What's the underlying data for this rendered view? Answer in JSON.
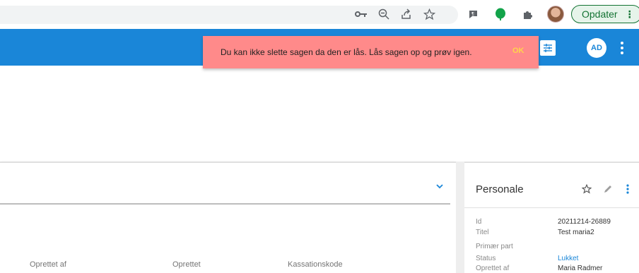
{
  "browser": {
    "icons": [
      "key-icon",
      "zoom-out-icon",
      "share-icon",
      "bookmark-star-icon",
      "extension-app-icon",
      "extension-green-icon",
      "puzzle-icon",
      "profile-avatar"
    ],
    "update_label": "Opdater",
    "update_more": "⋮"
  },
  "app": {
    "accent_color": "#1a86d8",
    "user_initials": "AD"
  },
  "toast": {
    "message": "Du kan ikke slette sagen da den er lås. Lås sagen op og prøv igen.",
    "ok_label": "OK",
    "background": "#ff8a8a"
  },
  "main": {
    "columns": [
      "Oprettet af",
      "Oprettet",
      "Kassationskode"
    ]
  },
  "panel": {
    "title": "Personale",
    "fields": [
      {
        "label": "Id",
        "value": "20211214-26889"
      },
      {
        "label": "Titel",
        "value": "Test maria2"
      },
      {
        "label": "Primær part",
        "value": ""
      },
      {
        "label": "Status",
        "value": "Lukket"
      },
      {
        "label": "Oprettet af",
        "value": "Maria Radmer"
      }
    ]
  }
}
